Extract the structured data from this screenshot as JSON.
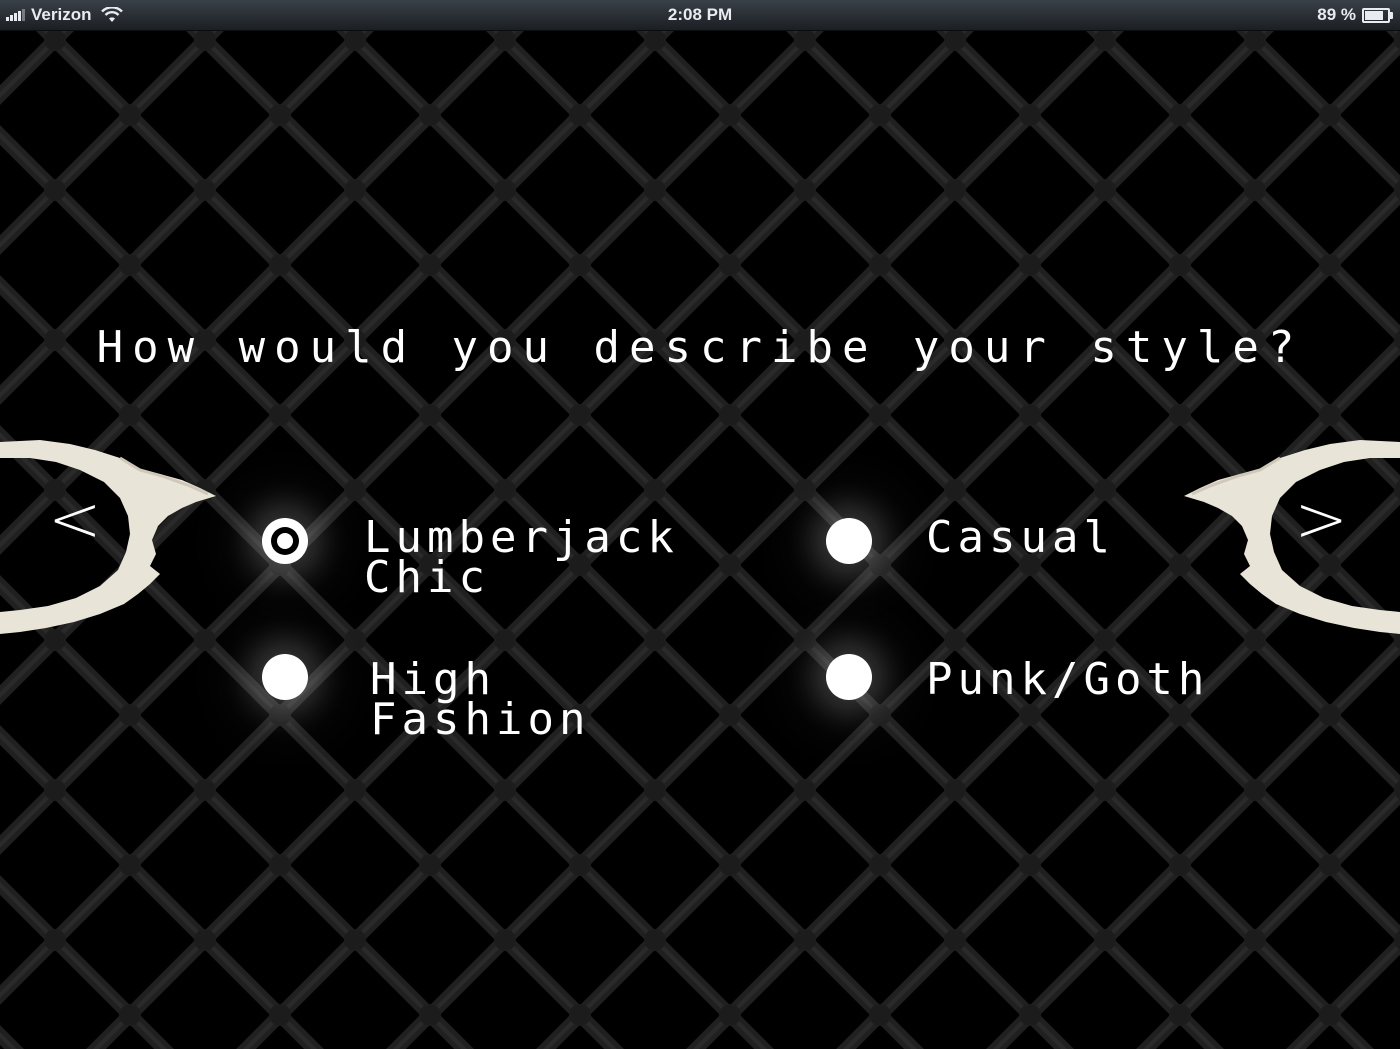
{
  "status_bar": {
    "carrier": "Verizon",
    "time": "2:08 PM",
    "battery_text": "89 %",
    "battery_level": 0.89,
    "icons": [
      "signal-icon",
      "wifi-icon",
      "battery-icon"
    ]
  },
  "quiz": {
    "question": "How would you describe your style?",
    "options": [
      {
        "label": "Lumberjack\nChic",
        "selected": true
      },
      {
        "label": "Casual",
        "selected": false
      },
      {
        "label": "High Fashion",
        "selected": false
      },
      {
        "label": "Punk/Goth",
        "selected": false
      }
    ]
  },
  "nav": {
    "prev_label": "<",
    "next_label": ">",
    "icons": [
      "torn-paper-icon",
      "chevron-left-icon",
      "chevron-right-icon"
    ]
  },
  "colors": {
    "background": "#000000",
    "fence": "#1e1e1e",
    "text": "#ffffff",
    "paper": "#e9e4d8"
  }
}
